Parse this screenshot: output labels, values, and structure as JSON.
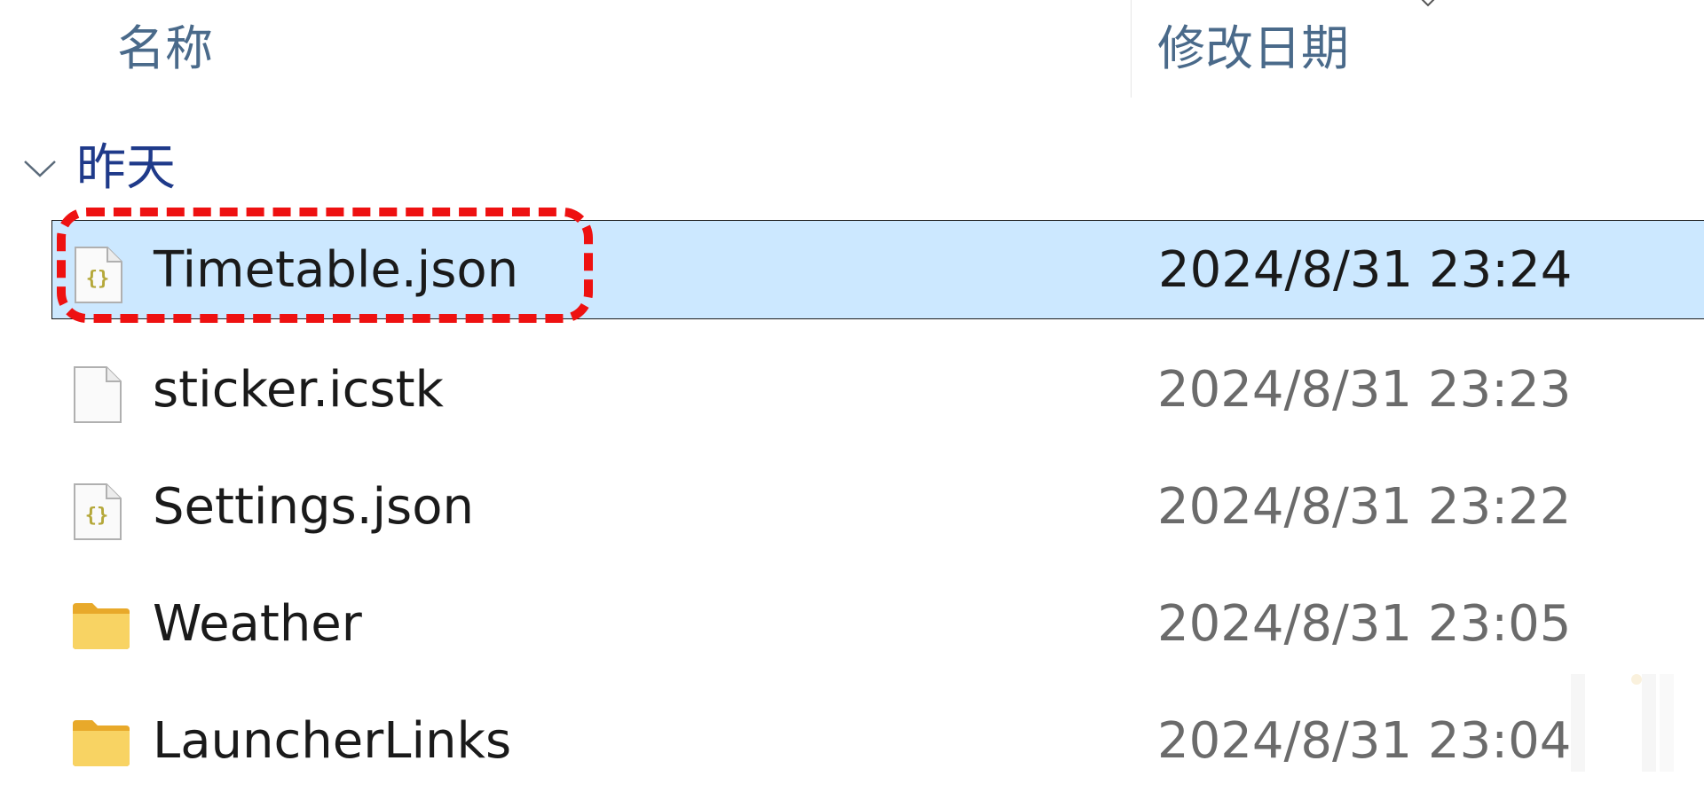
{
  "header": {
    "name_label": "名称",
    "date_label": "修改日期"
  },
  "group": {
    "label": "昨天"
  },
  "files": [
    {
      "name": "Timetable.json",
      "date": "2024/8/31 23:24",
      "icon": "json-file-icon",
      "selected": true
    },
    {
      "name": "sticker.icstk",
      "date": "2024/8/31 23:23",
      "icon": "blank-file-icon",
      "selected": false
    },
    {
      "name": "Settings.json",
      "date": "2024/8/31 23:22",
      "icon": "json-file-icon",
      "selected": false
    },
    {
      "name": "Weather",
      "date": "2024/8/31 23:05",
      "icon": "folder-icon",
      "selected": false
    },
    {
      "name": "LauncherLinks",
      "date": "2024/8/31 23:04",
      "icon": "folder-icon",
      "selected": false
    }
  ],
  "colors": {
    "selection_bg": "#cce8ff",
    "header_text": "#4a6a8a",
    "group_text": "#1f3a8a",
    "annotation_red": "#ee1111",
    "folder_yellow": "#f6c949"
  }
}
